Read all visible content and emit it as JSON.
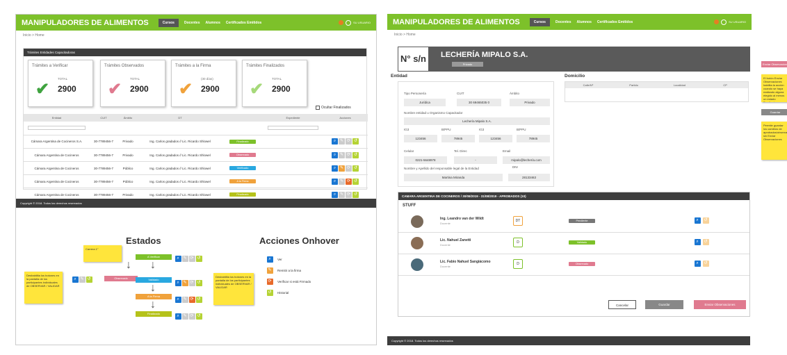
{
  "left": {
    "header": {
      "brand": "MANIPULADORES DE ALIMENTOS",
      "nav": [
        "Cursos",
        "Docentes",
        "Alumnos",
        "Certificados Emitidos"
      ],
      "user": "SU USUARIO"
    },
    "breadcrumb": "Inicio > Home",
    "panel_title": "Trámites Entidades Capacitadoras",
    "stats": [
      {
        "title": "Trámites a Verificar",
        "label": "TOTAL",
        "value": "2900",
        "color": "#3fa33f"
      },
      {
        "title": "Trámites Observados",
        "label": "TOTAL",
        "value": "2900",
        "color": "#e07a8f"
      },
      {
        "title": "Trámites a la Firma",
        "label": "(30 días)",
        "value": "2900",
        "color": "#f0a23c"
      },
      {
        "title": "Trámites Finalizados",
        "label": "TOTAL",
        "value": "2900",
        "color": "#a6d97a"
      }
    ],
    "checkbox_label": "Ocultar Finalizados",
    "table": {
      "headers": [
        "Entidad",
        "CUIT",
        "Ámbito",
        "DT",
        "",
        "Expediente",
        "Acciones"
      ],
      "rows": [
        {
          "entidad": "Cámara Argentina de Cocineros S.A.",
          "cuit": "30-7789456-7",
          "ambito": "Privado",
          "dt": "Ing. Carlos gradados // Lic. Ricardo Shlowel",
          "estado": "Finalizado",
          "color": "#7dc12a"
        },
        {
          "entidad": "Cámara Argentina de Cocineros",
          "cuit": "30-7789456-7",
          "ambito": "Privado",
          "dt": "Ing. Carlos gradados // Lic. Ricardo Shlowel",
          "estado": "Observado",
          "color": "#e07a8f"
        },
        {
          "entidad": "Cámara Argentina de Cocineros",
          "cuit": "30-7789456-7",
          "ambito": "Público",
          "dt": "Ing. Carlos gradados // Lic. Ricardo Shlowel",
          "estado": "Verificado",
          "color": "#29a8e0"
        },
        {
          "entidad": "Cámara Argentina de Cocineros",
          "cuit": "30-7789456-7",
          "ambito": "Público",
          "dt": "Ing. Carlos gradados // Lic. Ricardo Shlowel",
          "estado": "A la Firma",
          "color": "#f0a23c"
        },
        {
          "entidad": "Cámara Argentina de Cocineros",
          "cuit": "30-7789456-7",
          "ambito": "Privado",
          "dt": "Ing. Carlos gradados // Lic. Ricardo Shlowel",
          "estado": "Finalizado",
          "color": "#b5c21a"
        }
      ]
    },
    "footer": "Copyright © 2018. Todos los derechos reservados",
    "estados": {
      "title": "Estados",
      "note_top": "Carrera 1°",
      "note_left": "Deshabilita los botones en la pantalla de los participantes individuales de OBSERVAR / VALIDAR",
      "note_right": "Deshabilita los botones en la pantalla de los participantes individuales de OBSERVAR / VALIDAR",
      "flow": [
        "A Verificar",
        "Observado",
        "Validado",
        "A la Firma",
        "Finalizado"
      ]
    },
    "acciones": {
      "title": "Acciones Onhover",
      "items": [
        "Ver",
        "Remitir a la firma",
        "Verificar si está Firmado",
        "Historial"
      ]
    }
  },
  "right": {
    "header": {
      "brand": "MANIPULADORES DE ALIMENTOS",
      "nav": [
        "Cursos",
        "Docentes",
        "Alumnos",
        "Certificados Emitidos"
      ],
      "user": "SU USUARIO"
    },
    "breadcrumb": "Inicio > Home",
    "number": "N° s/n",
    "company": "LECHERÍA MIPALO S.A.",
    "company_tag": "Privado",
    "entidad_title": "Entidad",
    "domicilio_title": "Domicilio",
    "domicilio_headers": [
      "Calle/Nº",
      "Partido",
      "Localidad",
      "CP"
    ],
    "fields": {
      "tipo_label": "Tipo Personería",
      "tipo": "Jurídica",
      "cuit_label": "CUIT",
      "cuit": "30 69465035 0",
      "ambito_label": "Ámbito",
      "ambito": "Privado",
      "nombre_label": "Nombre entidad u Organismo Capacitador",
      "nombre": "Lechería Mipalo S.A.",
      "c1_label": "IG3",
      "c1": "123456",
      "c2_label": "B/PPU",
      "c2": "78945",
      "c3_label": "IG3",
      "c3": "123456",
      "c4_label": "B/PPU",
      "c4": "78945",
      "celular_label": "Celular",
      "celular": "0221-5648978",
      "tel_label": "Tel. Direc",
      "tel": "-",
      "email_label": "Email",
      "email": "mipalo@lechería.com",
      "resp_label": "Nombre y Apellido del responsable legal de la Entidad",
      "resp": "Martina Miranda",
      "dni_label": "DNI",
      "dni": "28133463"
    },
    "course_bar": "CAMARA ARGENTINA DE COCINEROS / 30/08/2019 - 31/08/2019 - APROBADOS (10)",
    "staff_title": "STUFF",
    "people": [
      {
        "name": "Ing. Leandro van der Wildt",
        "role": "Docente",
        "code": "DT",
        "estado": "Pendiente",
        "color": "#777"
      },
      {
        "name": "Lic. Nahuel Zanetti",
        "role": "Docente",
        "code": "D",
        "estado": "Validado",
        "color": "#7dc12a"
      },
      {
        "name": "Lic. Fabio Nahuel Sangiácomo",
        "role": "Docente",
        "code": "D",
        "estado": "Observado",
        "color": "#e07a8f"
      }
    ],
    "buttons": {
      "cancel": "Cancelar",
      "save": "Guardar",
      "send": "Enviar Observaciones"
    },
    "footer": "Copyright © 2018. Todos los derechos reservados"
  },
  "side": {
    "btn1": "Enviar Observaciones",
    "note1": "El botón Enviar Observaciones habilita la acción cuando se haya realizado alguna elegido al menos un estado Pendiente",
    "btn2": "Guardar",
    "note2": "Permite guardar los cambios de aprobados/observados sin Enviar Observaciones"
  }
}
